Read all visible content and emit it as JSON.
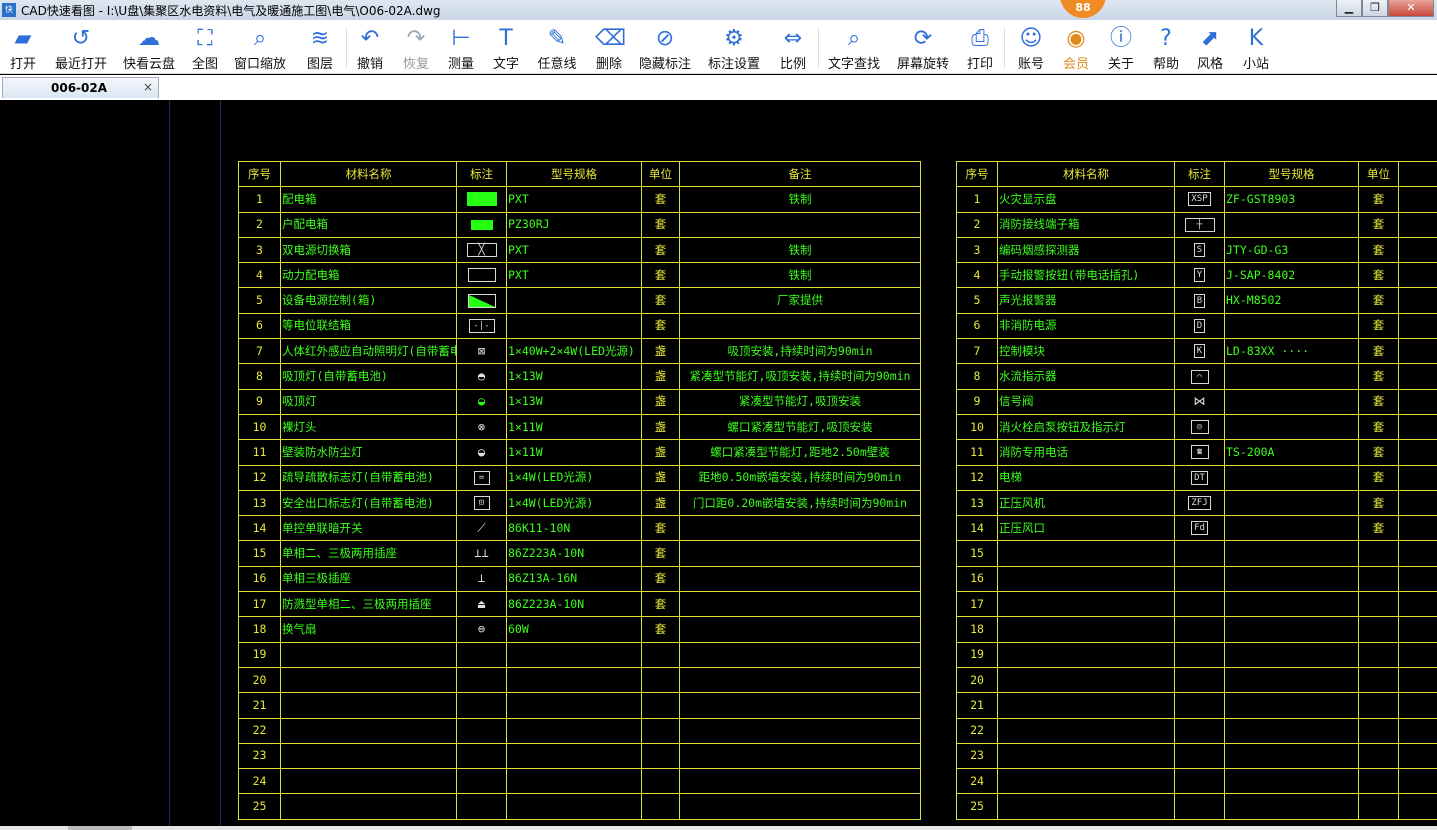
{
  "window": {
    "title": "CAD快速看图 - I:\\U盘\\集聚区水电资料\\电气及暖通施工图\\电气\\O06-02A.dwg",
    "vip_badge": "88",
    "min_icon": "minimize-icon",
    "max_icon": "maximize-icon",
    "close_icon": "close-icon"
  },
  "toolbar": {
    "items": [
      {
        "label": "打开",
        "icon": "folder-open-icon"
      },
      {
        "label": "最近打开",
        "icon": "history-icon"
      },
      {
        "label": "快看云盘",
        "icon": "cloud-icon"
      },
      {
        "label": "全图",
        "icon": "fit-view-icon"
      },
      {
        "label": "窗口缩放",
        "icon": "window-zoom-icon"
      },
      {
        "label": "图层",
        "icon": "layers-icon"
      },
      {
        "label": "撤销",
        "icon": "undo-icon"
      },
      {
        "label": "恢复",
        "icon": "redo-icon"
      },
      {
        "label": "测量",
        "icon": "measure-icon"
      },
      {
        "label": "文字",
        "icon": "text-icon"
      },
      {
        "label": "任意线",
        "icon": "freehand-line-icon"
      },
      {
        "label": "删除",
        "icon": "eraser-icon"
      },
      {
        "label": "隐藏标注",
        "icon": "hide-annotation-icon"
      },
      {
        "label": "标注设置",
        "icon": "annotation-settings-icon"
      },
      {
        "label": "比例",
        "icon": "scale-icon"
      },
      {
        "label": "文字查找",
        "icon": "text-search-icon"
      },
      {
        "label": "屏幕旋转",
        "icon": "rotate-screen-icon"
      },
      {
        "label": "打印",
        "icon": "print-icon"
      },
      {
        "label": "账号",
        "icon": "account-icon"
      },
      {
        "label": "会员",
        "icon": "vip-icon"
      },
      {
        "label": "关于",
        "icon": "info-icon"
      },
      {
        "label": "帮助",
        "icon": "help-icon"
      },
      {
        "label": "风格",
        "icon": "style-icon"
      },
      {
        "label": "小站",
        "icon": "kuaikan-station-icon"
      }
    ]
  },
  "tab": {
    "label": "006-02A",
    "close": "×"
  },
  "left_table": {
    "headers": [
      "序号",
      "材料名称",
      "标注",
      "型号规格",
      "单位",
      "备注"
    ],
    "rows": [
      [
        "1",
        "配电箱",
        "filled-rect",
        "PXT",
        "套",
        "铁制"
      ],
      [
        "2",
        "户配电箱",
        "filled-rect-small",
        "PZ30RJ",
        "套",
        ""
      ],
      [
        "3",
        "双电源切换箱",
        "cross-box",
        "PXT",
        "套",
        "铁制"
      ],
      [
        "4",
        "动力配电箱",
        "empty-rect",
        "PXT",
        "套",
        "铁制"
      ],
      [
        "5",
        "设备电源控制(箱)",
        "half-filled-rect",
        "",
        "套",
        "厂家提供"
      ],
      [
        "6",
        "等电位联结箱",
        "equipotential-box",
        "",
        "套",
        ""
      ],
      [
        "7",
        "人体红外感应自动照明灯(自带蓄电池)",
        "sensor-lamp",
        "1×40W+2×4W(LED光源)",
        "盏",
        "吸顶安装,持续时间为90min"
      ],
      [
        "8",
        "吸顶灯(自带蓄电池)",
        "ceiling-lamp-battery",
        "1×13W",
        "盏",
        "紧凑型节能灯,吸顶安装,持续时间为90min"
      ],
      [
        "9",
        "吸顶灯",
        "ceiling-lamp",
        "1×13W",
        "盏",
        "紧凑型节能灯,吸顶安装"
      ],
      [
        "10",
        "裸灯头",
        "bare-lamp",
        "1×11W",
        "盏",
        "螺口紧凑型节能灯,吸顶安装"
      ],
      [
        "11",
        "壁装防水防尘灯",
        "wall-waterproof-lamp",
        "1×11W",
        "盏",
        "螺口紧凑型节能灯,距地2.50m壁装"
      ],
      [
        "12",
        "疏导疏散标志灯(自带蓄电池)",
        "evac-sign",
        "1×4W(LED光源)",
        "盏",
        "距地0.50m嵌墙安装,持续时间为90min"
      ],
      [
        "13",
        "安全出口标志灯(自带蓄电池)",
        "exit-sign",
        "1×4W(LED光源)",
        "盏",
        "门口距0.20m嵌墙安装,持续时间为90min"
      ],
      [
        "14",
        "单控单联暗开关",
        "switch",
        "86K11-10N",
        "套",
        ""
      ],
      [
        "15",
        "单相二、三极两用插座",
        "socket-2-3",
        "86Z223A-10N",
        "套",
        ""
      ],
      [
        "16",
        "单相三极插座",
        "socket-3",
        "86Z13A-16N",
        "套",
        ""
      ],
      [
        "17",
        "防溅型单相二、三极两用插座",
        "socket-splash",
        "86Z223A-10N",
        "套",
        ""
      ],
      [
        "18",
        "换气扇",
        "fan",
        "60W",
        "套",
        ""
      ],
      [
        "19",
        "",
        "",
        "",
        "",
        ""
      ],
      [
        "20",
        "",
        "",
        "",
        "",
        ""
      ],
      [
        "21",
        "",
        "",
        "",
        "",
        ""
      ],
      [
        "22",
        "",
        "",
        "",
        "",
        ""
      ],
      [
        "23",
        "",
        "",
        "",
        "",
        ""
      ],
      [
        "24",
        "",
        "",
        "",
        "",
        ""
      ],
      [
        "25",
        "",
        "",
        "",
        "",
        ""
      ]
    ]
  },
  "right_table": {
    "headers": [
      "序号",
      "材料名称",
      "标注",
      "型号规格",
      "单位"
    ],
    "rows": [
      [
        "1",
        "火灾显示盘",
        "XSP",
        "ZF-GST8903",
        "套"
      ],
      [
        "2",
        "消防接线端子箱",
        "terminal-box",
        "",
        "套"
      ],
      [
        "3",
        "编码烟感探测器",
        "S",
        "JTY-GD-G3",
        "套"
      ],
      [
        "4",
        "手动报警按钮(带电话插孔)",
        "Y",
        "J-SAP-8402",
        "套"
      ],
      [
        "5",
        "声光报警器",
        "B",
        "HX-M8502",
        "套"
      ],
      [
        "6",
        "非消防电源",
        "D",
        "",
        "套"
      ],
      [
        "7",
        "控制模块",
        "K",
        "LD-83XX  ····",
        "套"
      ],
      [
        "8",
        "水流指示器",
        "flow-indicator",
        "",
        "套"
      ],
      [
        "9",
        "信号阀",
        "signal-valve",
        "",
        "套"
      ],
      [
        "10",
        "消火栓启泵按钮及指示灯",
        "hydrant-button",
        "",
        "套"
      ],
      [
        "11",
        "消防专用电话",
        "fire-phone",
        "TS-200A",
        "套"
      ],
      [
        "12",
        "电梯",
        "DT",
        "",
        "套"
      ],
      [
        "13",
        "正压风机",
        "ZFJ",
        "",
        "套"
      ],
      [
        "14",
        "正压风口",
        "Fd",
        "",
        "套"
      ],
      [
        "15",
        "",
        "",
        "",
        ""
      ],
      [
        "16",
        "",
        "",
        "",
        ""
      ],
      [
        "17",
        "",
        "",
        "",
        ""
      ],
      [
        "18",
        "",
        "",
        "",
        ""
      ],
      [
        "19",
        "",
        "",
        "",
        ""
      ],
      [
        "20",
        "",
        "",
        "",
        ""
      ],
      [
        "21",
        "",
        "",
        "",
        ""
      ],
      [
        "22",
        "",
        "",
        "",
        ""
      ],
      [
        "23",
        "",
        "",
        "",
        ""
      ],
      [
        "24",
        "",
        "",
        "",
        ""
      ],
      [
        "25",
        "",
        "",
        "",
        ""
      ]
    ]
  }
}
